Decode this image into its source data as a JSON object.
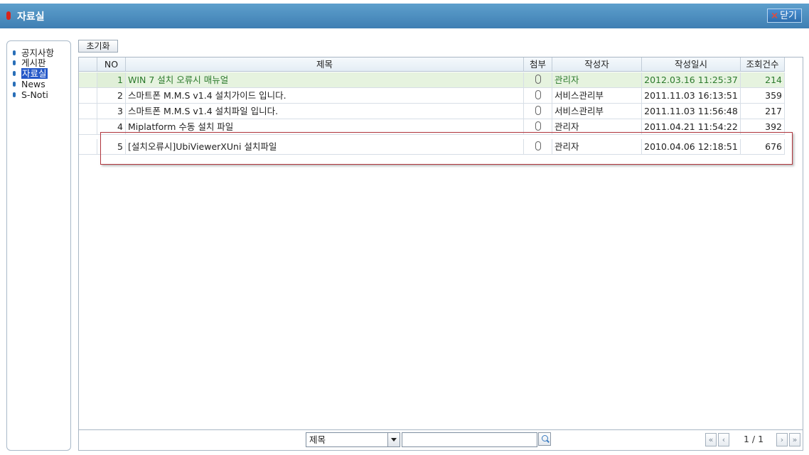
{
  "window": {
    "title": "자료실",
    "close_label": "닫기"
  },
  "sidebar": {
    "items": [
      {
        "label": "공지사항",
        "active": false
      },
      {
        "label": "게시판",
        "active": false
      },
      {
        "label": "자료실",
        "active": true
      },
      {
        "label": "News",
        "active": false
      },
      {
        "label": "S-Noti",
        "active": false
      }
    ]
  },
  "toolbar": {
    "reset_label": "초기화"
  },
  "table": {
    "columns": [
      "NO",
      "제목",
      "첨부",
      "작성자",
      "작성일시",
      "조회건수"
    ],
    "rows": [
      {
        "no": "1",
        "title": "WIN 7 설치 오류시 매뉴얼",
        "attach": "paperclip-icon",
        "author": "관리자",
        "date": "2012.03.16 11:25:37",
        "views": "214"
      },
      {
        "no": "2",
        "title": "스마트폰 M.M.S v1.4 설치가이드 입니다.",
        "attach": "paperclip-icon",
        "author": "서비스관리부",
        "date": "2011.11.03 16:13:51",
        "views": "359"
      },
      {
        "no": "3",
        "title": "스마트폰 M.M.S v1.4 설치파일 입니다.",
        "attach": "paperclip-icon",
        "author": "서비스관리부",
        "date": "2011.11.03 11:56:48",
        "views": "217"
      },
      {
        "no": "4",
        "title": "Miplatform 수동 설치 파일",
        "attach": "paperclip-icon",
        "author": "관리자",
        "date": "2011.04.21 11:54:22",
        "views": "392"
      },
      {
        "no": "5",
        "title": "[설치오류시]UbiViewerXUni 설치파일",
        "attach": "paperclip-icon",
        "author": "관리자",
        "date": "2010.04.06 12:18:51",
        "views": "676"
      }
    ]
  },
  "search": {
    "field_selected": "제목",
    "query": ""
  },
  "pagination": {
    "page_text": "1 / 1"
  },
  "colors": {
    "titlebar": "#4a8bbf",
    "highlight_row": "#e6f3df",
    "highlight_text": "#2c7a2c",
    "annotation_box": "#b0353d"
  }
}
